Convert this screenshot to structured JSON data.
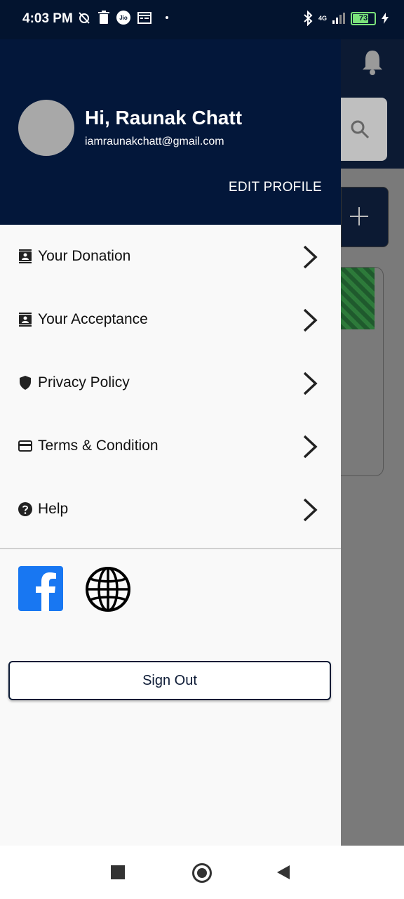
{
  "status_bar": {
    "time": "4:03 PM",
    "carrier_badge": "Jio",
    "network": "4G",
    "battery": "73"
  },
  "profile": {
    "greeting": "Hi, Raunak Chatt",
    "email": "iamraunakchatt@gmail.com",
    "edit_label": "EDIT PROFILE"
  },
  "menu": {
    "items": [
      {
        "label": "Your Donation",
        "icon": "contact-card-icon"
      },
      {
        "label": "Your Acceptance",
        "icon": "contact-card-icon"
      },
      {
        "label": "Privacy Policy",
        "icon": "shield-icon"
      },
      {
        "label": "Terms & Condition",
        "icon": "credit-card-icon"
      },
      {
        "label": "Help",
        "icon": "help-circle-icon"
      }
    ]
  },
  "actions": {
    "signout_label": "Sign Out"
  },
  "colors": {
    "header": "#03173a",
    "facebook": "#1877f2"
  }
}
